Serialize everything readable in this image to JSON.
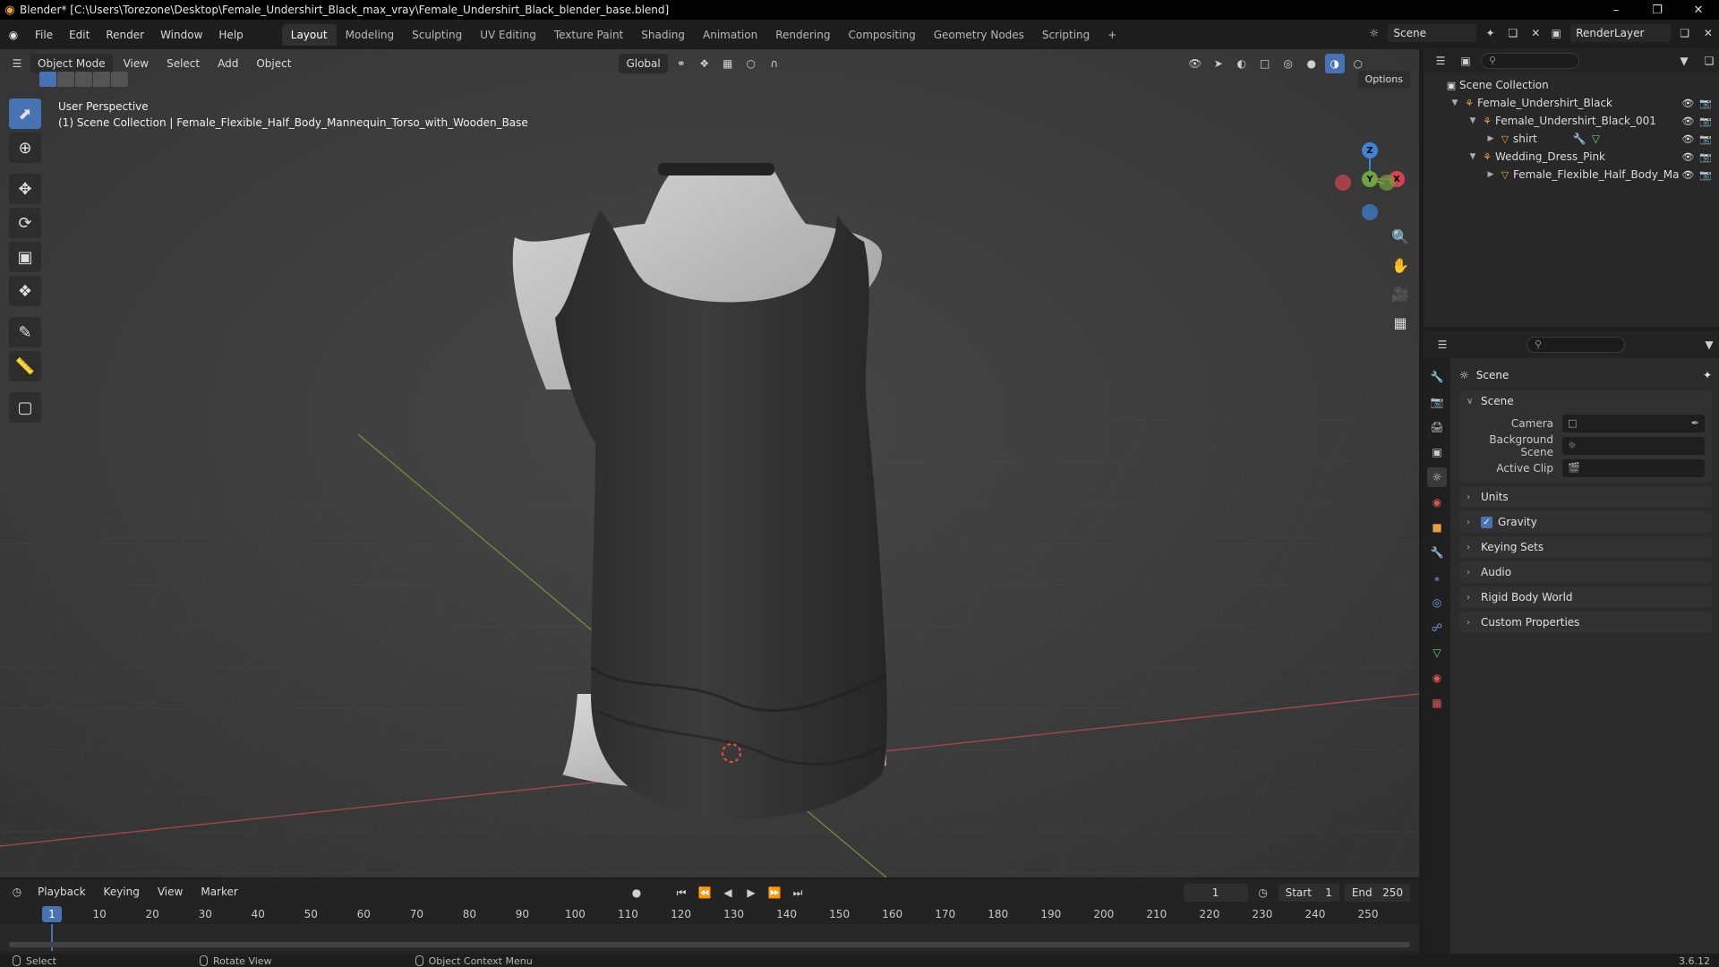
{
  "titlebar": {
    "title": "Blender* [C:\\Users\\Torezone\\Desktop\\Female_Undershirt_Black_max_vray\\Female_Undershirt_Black_blender_base.blend]",
    "minimize": "–",
    "maximize": "❐",
    "close": "✕"
  },
  "menu": [
    "File",
    "Edit",
    "Render",
    "Window",
    "Help"
  ],
  "workspaces": [
    "Layout",
    "Modeling",
    "Sculpting",
    "UV Editing",
    "Texture Paint",
    "Shading",
    "Animation",
    "Rendering",
    "Compositing",
    "Geometry Nodes",
    "Scripting"
  ],
  "workspace_add": "+",
  "scene_selector": {
    "value": "Scene"
  },
  "renderlayer_selector": {
    "value": "RenderLayer"
  },
  "viewport": {
    "mode": "Object Mode",
    "menus": [
      "View",
      "Select",
      "Add",
      "Object"
    ],
    "orientation": "Global",
    "options": "Options",
    "info_line1": "User Perspective",
    "info_line2": "(1) Scene Collection | Female_Flexible_Half_Body_Mannequin_Torso_with_Wooden_Base",
    "gizmo": {
      "x": "X",
      "y": "Y",
      "z": "Z"
    }
  },
  "outliner": {
    "search_placeholder": "",
    "root": "Scene Collection",
    "items": [
      {
        "label": "Female_Undershirt_Black",
        "level": 1
      },
      {
        "label": "Female_Undershirt_Black_001",
        "level": 2
      },
      {
        "label": "shirt",
        "level": 3
      },
      {
        "label": "Wedding_Dress_Pink",
        "level": 2
      },
      {
        "label": "Female_Flexible_Half_Body_Ma",
        "level": 3
      }
    ]
  },
  "properties": {
    "context": "Scene",
    "scene_panel": {
      "title": "Scene",
      "camera_label": "Camera",
      "background_label": "Background Scene",
      "clip_label": "Active Clip"
    },
    "panels": [
      "Units",
      "Gravity",
      "Keying Sets",
      "Audio",
      "Rigid Body World",
      "Custom Properties"
    ],
    "gravity_checked": true
  },
  "timeline": {
    "menus": [
      "Playback",
      "Keying",
      "View",
      "Marker"
    ],
    "current_frame": "1",
    "start_label": "Start",
    "start_value": "1",
    "end_label": "End",
    "end_value": "250",
    "ticks": [
      "1",
      "10",
      "20",
      "30",
      "40",
      "50",
      "60",
      "70",
      "80",
      "90",
      "100",
      "110",
      "120",
      "130",
      "140",
      "150",
      "160",
      "170",
      "180",
      "190",
      "200",
      "210",
      "220",
      "230",
      "240",
      "250"
    ]
  },
  "statusbar": {
    "select": "Select",
    "rotate": "Rotate View",
    "context": "Object Context Menu",
    "version": "3.6.12"
  },
  "colors": {
    "accent": "#4772b3",
    "x_axis": "#d4454f",
    "y_axis": "#6ba53c",
    "z_axis": "#3d83d8"
  }
}
